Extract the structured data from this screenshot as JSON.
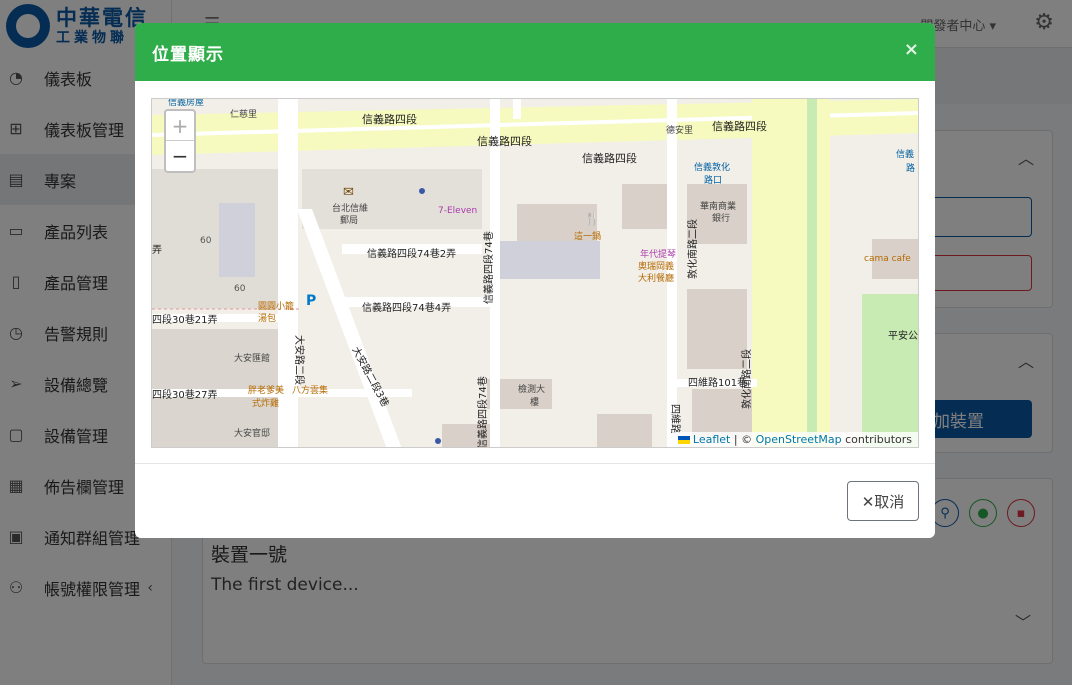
{
  "brand": {
    "line1": "中華電信",
    "line2": "工業物聯"
  },
  "sidebar": {
    "items": [
      {
        "label": "儀表板",
        "icon": "dashboard-icon"
      },
      {
        "label": "儀表板管理",
        "icon": "grid-icon"
      },
      {
        "label": "專案",
        "icon": "list-icon",
        "active": true
      },
      {
        "label": "產品列表",
        "icon": "devices-icon"
      },
      {
        "label": "產品管理",
        "icon": "tablet-icon"
      },
      {
        "label": "告警規則",
        "icon": "clock-icon"
      },
      {
        "label": "設備總覽",
        "icon": "send-icon"
      },
      {
        "label": "設備管理",
        "icon": "file-icon"
      },
      {
        "label": "佈告欄管理",
        "icon": "board-icon"
      },
      {
        "label": "通知群組管理",
        "icon": "contact-icon"
      },
      {
        "label": "帳號權限管理",
        "icon": "users-icon",
        "caret": "‹"
      }
    ]
  },
  "topbar": {
    "dev_center": "開發者中心 ▾"
  },
  "background": {
    "add_device": "批次增加裝置",
    "device_title": "裝置一號",
    "device_desc": "The first device..."
  },
  "modal": {
    "title": "位置顯示",
    "close": "×",
    "cancel": "✕取消",
    "accent": "#2fad4a"
  },
  "map": {
    "zoom_in": "+",
    "zoom_out": "−",
    "attribution": {
      "leaflet": "Leaflet",
      "sep": " | © ",
      "osm": "OpenStreetMap",
      "tail": " contributors"
    },
    "labels": {
      "road_top1": "信義路四段",
      "road_top2": "信義路四段",
      "road_top3": "信義路四段",
      "road_top4": "信義路四段",
      "renci": "仁慈里",
      "dean": "德安里",
      "xinyi_house": "信義房屋",
      "post1": "台北信維",
      "post2": "郵局",
      "seven": "7-Eleven",
      "zheyiguo": "這一鍋",
      "lane74_2": "信義路四段74巷2弄",
      "lane74_4": "信義路四段74巷4弄",
      "lane74": "信義路四段74巷",
      "lane30_21": "四段30巷21弄",
      "lane30_27": "四段30巷27弄",
      "daan_road": "大安路二段",
      "daan_lane3": "大安路二段3巷",
      "yuanyuan1": "圓圓小籠",
      "yuanyuan2": "湯包",
      "daanhui": "大安匯館",
      "panglao1": "胖老爹美",
      "panglao2": "式炸雞",
      "bafang": "八方雲集",
      "daanguan": "大安官邸",
      "jiance1": "檢測大",
      "jiance2": "樓",
      "nianta1": "年代提琴",
      "nianta2": "奧瑞岡義",
      "nianta3": "大利餐廳",
      "huanan1": "華南商業",
      "huanan2": "銀行",
      "dunhua_station1": "信義敦化",
      "dunhua_station2": "路口",
      "dunhua1": "敦化南路二段",
      "dunhua2": "敦化南路二段",
      "siwei": "四維路101巷",
      "siwei_road": "四維路",
      "cama": "cama cafe",
      "pingan": "平安公",
      "num60a": "60",
      "num60b": "60",
      "xinyi_right1": "信義",
      "xinyi_right2": "路",
      "west_lane": "弄"
    }
  }
}
